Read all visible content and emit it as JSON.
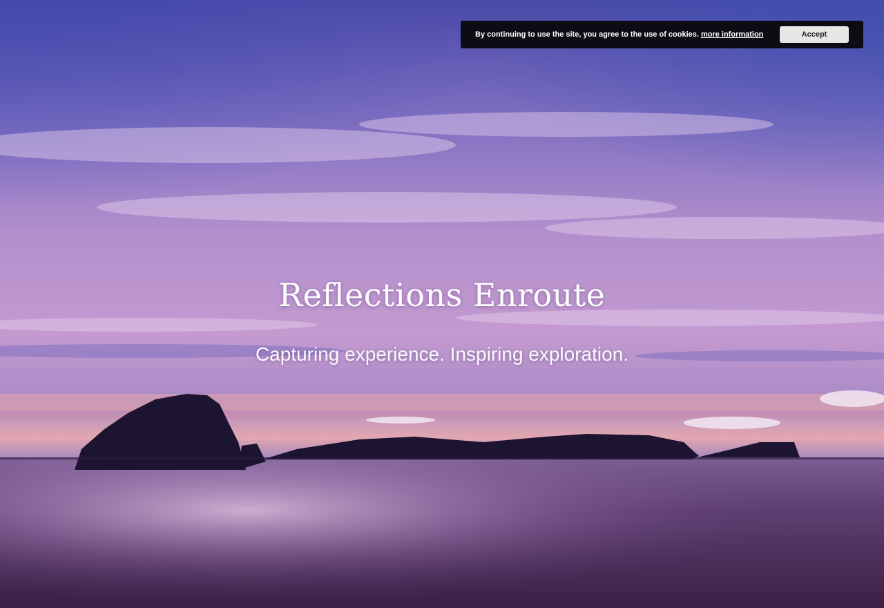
{
  "hero": {
    "title": "Reflections Enroute",
    "tagline": "Capturing experience. Inspiring exploration."
  },
  "cookie_notice": {
    "message": "By continuing to use the site, you agree to the use of cookies.",
    "link_label": "more information",
    "accept_label": "Accept"
  },
  "colors": {
    "sky_top": "#5b56b4",
    "sky_mid": "#b48cc8",
    "horizon_glow": "#e8a8a8",
    "sea": "#4a2f5c",
    "silhouette": "#1c1430",
    "cookie_bar_bg": "#0d0b14"
  }
}
